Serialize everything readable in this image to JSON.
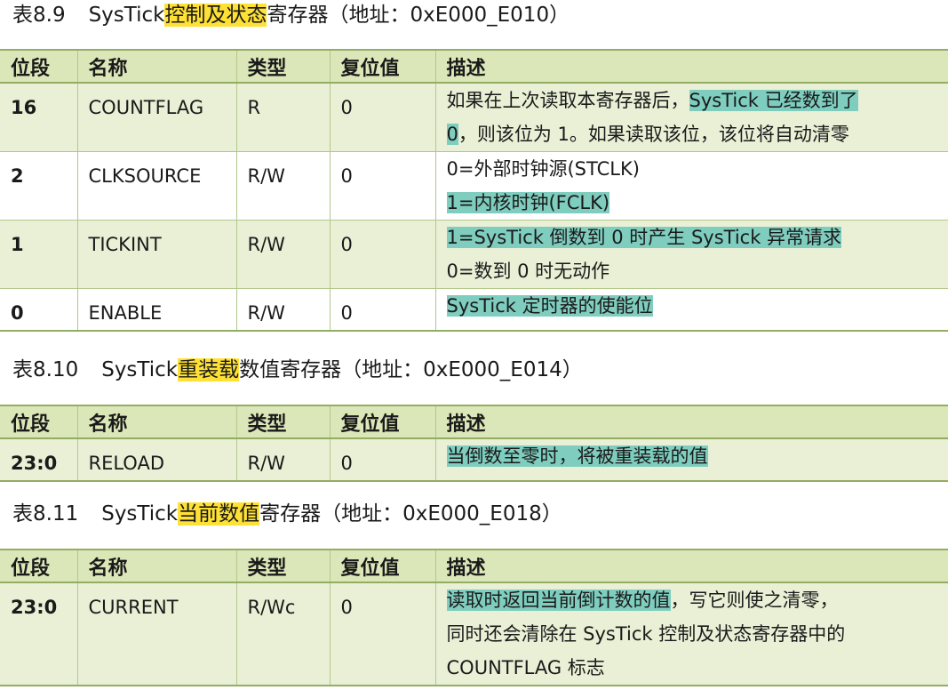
{
  "tables": [
    {
      "caption": {
        "number": "表8.9",
        "pre": "SysTick",
        "highlight": "控制及状态",
        "post": "寄存器（地址：0xE000_E010）"
      },
      "headers": [
        "位段",
        "名称",
        "类型",
        "复位值",
        "描述"
      ],
      "rows": [
        {
          "bits": "16",
          "name": "COUNTFLAG",
          "type": "R",
          "reset": "0",
          "desc": [
            {
              "pre": "如果在上次读取本寄存器后，",
              "hl": "SysTick 已经数到了",
              "post": ""
            },
            {
              "pre": "",
              "hl": "0",
              "post": "，则该位为 1。如果读取该位，该位将自动清零"
            }
          ]
        },
        {
          "bits": "2",
          "name": "CLKSOURCE",
          "type": "R/W",
          "reset": "0",
          "desc": [
            {
              "pre": "0=外部时钟源(STCLK)",
              "hl": "",
              "post": ""
            },
            {
              "pre": "",
              "hl": "1=内核时钟(FCLK)",
              "post": ""
            }
          ]
        },
        {
          "bits": "1",
          "name": "TICKINT",
          "type": "R/W",
          "reset": "0",
          "desc": [
            {
              "pre": "",
              "hl": "1=SysTick 倒数到 0 时产生 SysTick 异常请求",
              "post": ""
            },
            {
              "pre": "0=数到 0 时无动作",
              "hl": "",
              "post": ""
            }
          ]
        },
        {
          "bits": "0",
          "name": "ENABLE",
          "type": "R/W",
          "reset": "0",
          "desc": [
            {
              "pre": "",
              "hl": "SysTick 定时器的使能位",
              "post": ""
            }
          ]
        }
      ]
    },
    {
      "caption": {
        "number": "表8.10",
        "pre": "SysTick",
        "highlight": "重装载",
        "post": "数值寄存器（地址：0xE000_E014）"
      },
      "headers": [
        "位段",
        "名称",
        "类型",
        "复位值",
        "描述"
      ],
      "rows": [
        {
          "bits": "23:0",
          "name": "RELOAD",
          "type": "R/W",
          "reset": "0",
          "desc": [
            {
              "pre": "",
              "hl": "当倒数至零时，将被重装载的值",
              "post": ""
            }
          ]
        }
      ]
    },
    {
      "caption": {
        "number": "表8.11",
        "pre": "SysTick",
        "highlight": "当前数值",
        "post": "寄存器（地址：0xE000_E018）"
      },
      "headers": [
        "位段",
        "名称",
        "类型",
        "复位值",
        "描述"
      ],
      "rows": [
        {
          "bits": "23:0",
          "name": "CURRENT",
          "type": "R/Wc",
          "reset": "0",
          "desc": [
            {
              "pre": "",
              "hl": "读取时返回当前倒计数的值",
              "post": "，写它则使之清零，"
            },
            {
              "pre": "同时还会清除在 SysTick 控制及状态寄存器中的",
              "hl": "",
              "post": ""
            },
            {
              "pre": "COUNTFLAG 标志",
              "hl": "",
              "post": ""
            }
          ]
        }
      ]
    }
  ]
}
